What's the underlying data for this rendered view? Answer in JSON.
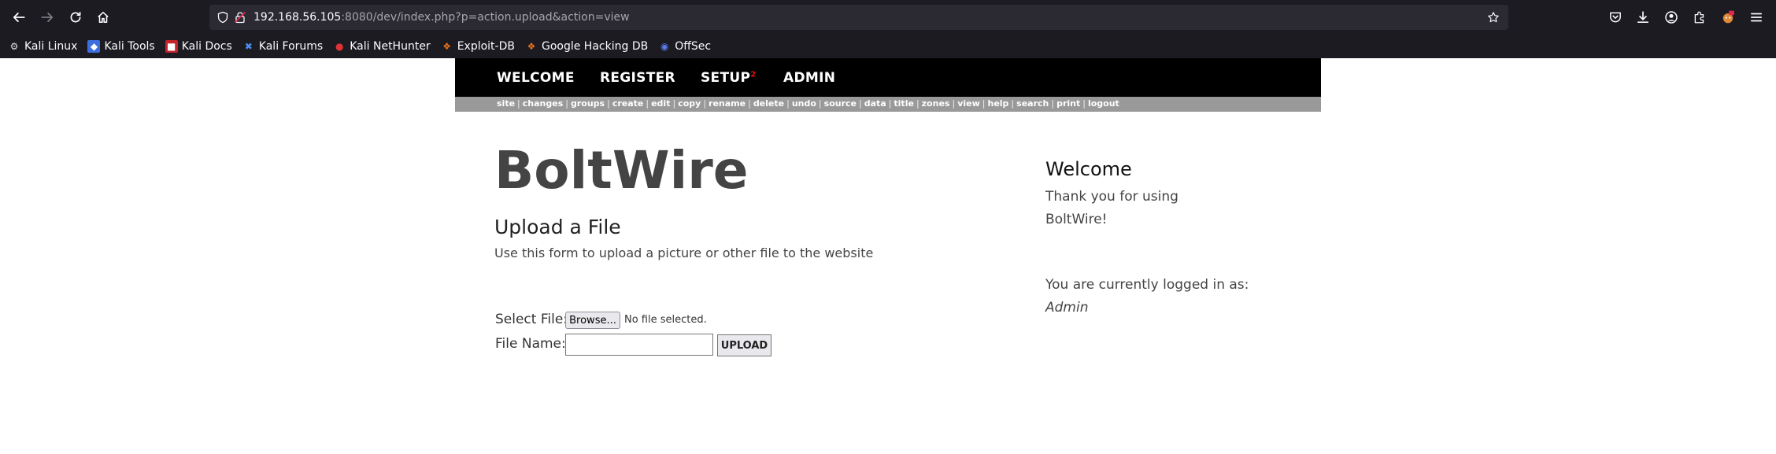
{
  "browser": {
    "url_host": "192.168.56.105",
    "url_rest": ":8080/dev/index.php?p=action.upload&action=view",
    "bookmarks": [
      {
        "label": "Kali Linux",
        "icon": "kali-dragon-icon"
      },
      {
        "label": "Kali Tools",
        "icon": "kali-tools-icon"
      },
      {
        "label": "Kali Docs",
        "icon": "kali-docs-icon"
      },
      {
        "label": "Kali Forums",
        "icon": "kali-forums-icon"
      },
      {
        "label": "Kali NetHunter",
        "icon": "nethunter-icon"
      },
      {
        "label": "Exploit-DB",
        "icon": "exploit-db-icon"
      },
      {
        "label": "Google Hacking DB",
        "icon": "ghdb-icon"
      },
      {
        "label": "OffSec",
        "icon": "offsec-icon"
      }
    ]
  },
  "site": {
    "nav": {
      "welcome": "WELCOME",
      "register": "REGISTER",
      "setup": "SETUP",
      "setup_badge": "2",
      "admin": "ADMIN"
    },
    "actions": [
      "site",
      "changes",
      "groups",
      "create",
      "edit",
      "copy",
      "rename",
      "delete",
      "undo",
      "source",
      "data",
      "title",
      "zones",
      "view",
      "help",
      "search",
      "print",
      "logout"
    ],
    "title": "BoltWire",
    "upload": {
      "heading": "Upload a File",
      "description": "Use this form to upload a picture or other file to the website",
      "select_label": "Select File:",
      "browse_label": "Browse...",
      "no_file": "No file selected.",
      "filename_label": "File Name:",
      "filename_value": "",
      "upload_label": "UPLOAD"
    },
    "sidebar": {
      "title": "Welcome",
      "line1": "Thank you for using",
      "line2": "BoltWire!",
      "logged_in": "You are currently logged in as:",
      "user": "Admin"
    }
  },
  "colors": {
    "chrome_bg": "#1c1b22",
    "urlbar_bg": "#2b2a33",
    "nav_bg": "#000000",
    "action_bar_bg": "#999999",
    "title_color": "#444444"
  }
}
